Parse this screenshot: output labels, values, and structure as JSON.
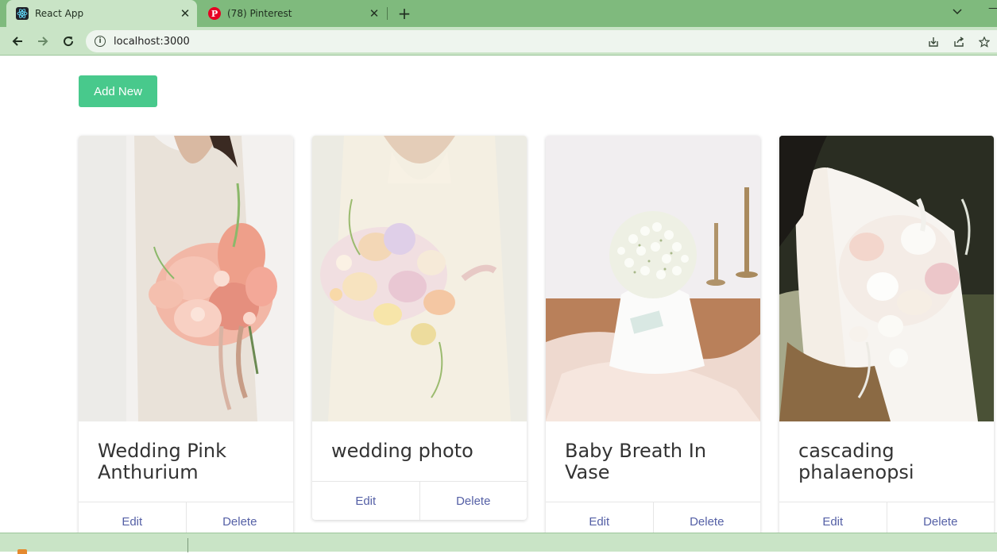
{
  "browser": {
    "tabs": [
      {
        "title": "React App",
        "icon": "react-icon",
        "active": true
      },
      {
        "title": "(78) Pinterest",
        "icon": "pinterest-icon",
        "active": false
      }
    ],
    "new_tab_symbol": "+",
    "close_symbol": "✕",
    "address": "localhost:3000"
  },
  "page": {
    "add_button_label": "Add New",
    "accent_color": "#48c98c",
    "action_link_color": "#5560a6",
    "cards": [
      {
        "title": "Wedding Pink Anthurium",
        "edit_label": "Edit",
        "delete_label": "Delete"
      },
      {
        "title": "wedding photo",
        "edit_label": "Edit",
        "delete_label": "Delete"
      },
      {
        "title": "Baby Breath In Vase",
        "edit_label": "Edit",
        "delete_label": "Delete"
      },
      {
        "title": "cascading phalaenopsi",
        "edit_label": "Edit",
        "delete_label": "Delete"
      }
    ]
  }
}
